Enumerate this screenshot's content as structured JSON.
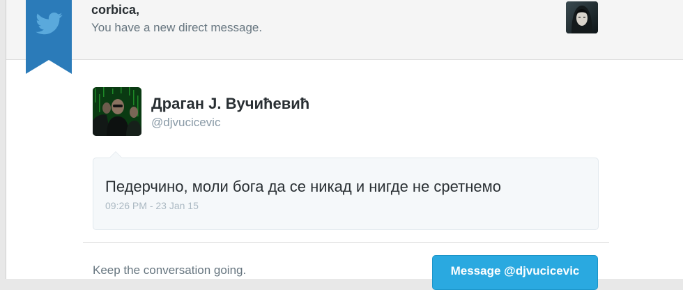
{
  "header": {
    "recipient_name": "corbica,",
    "notice": "You have a new direct message."
  },
  "sender": {
    "name": "Драган Ј. Вучићевић",
    "handle": "@djvucicevic"
  },
  "message": {
    "text": "Педерчино, моли бога да се никад и нигде не сретнемо",
    "timestamp": "09:26 PM - 23 Jan 15"
  },
  "footer": {
    "prompt": "Keep the conversation going.",
    "button_label": "Message @djvucicevic"
  },
  "colors": {
    "brand_blue": "#2aa9e0",
    "ribbon_blue": "#2b7bb9",
    "bubble_bg": "#f5f8fa"
  },
  "icons": {
    "ribbon": "twitter-bird-icon"
  }
}
